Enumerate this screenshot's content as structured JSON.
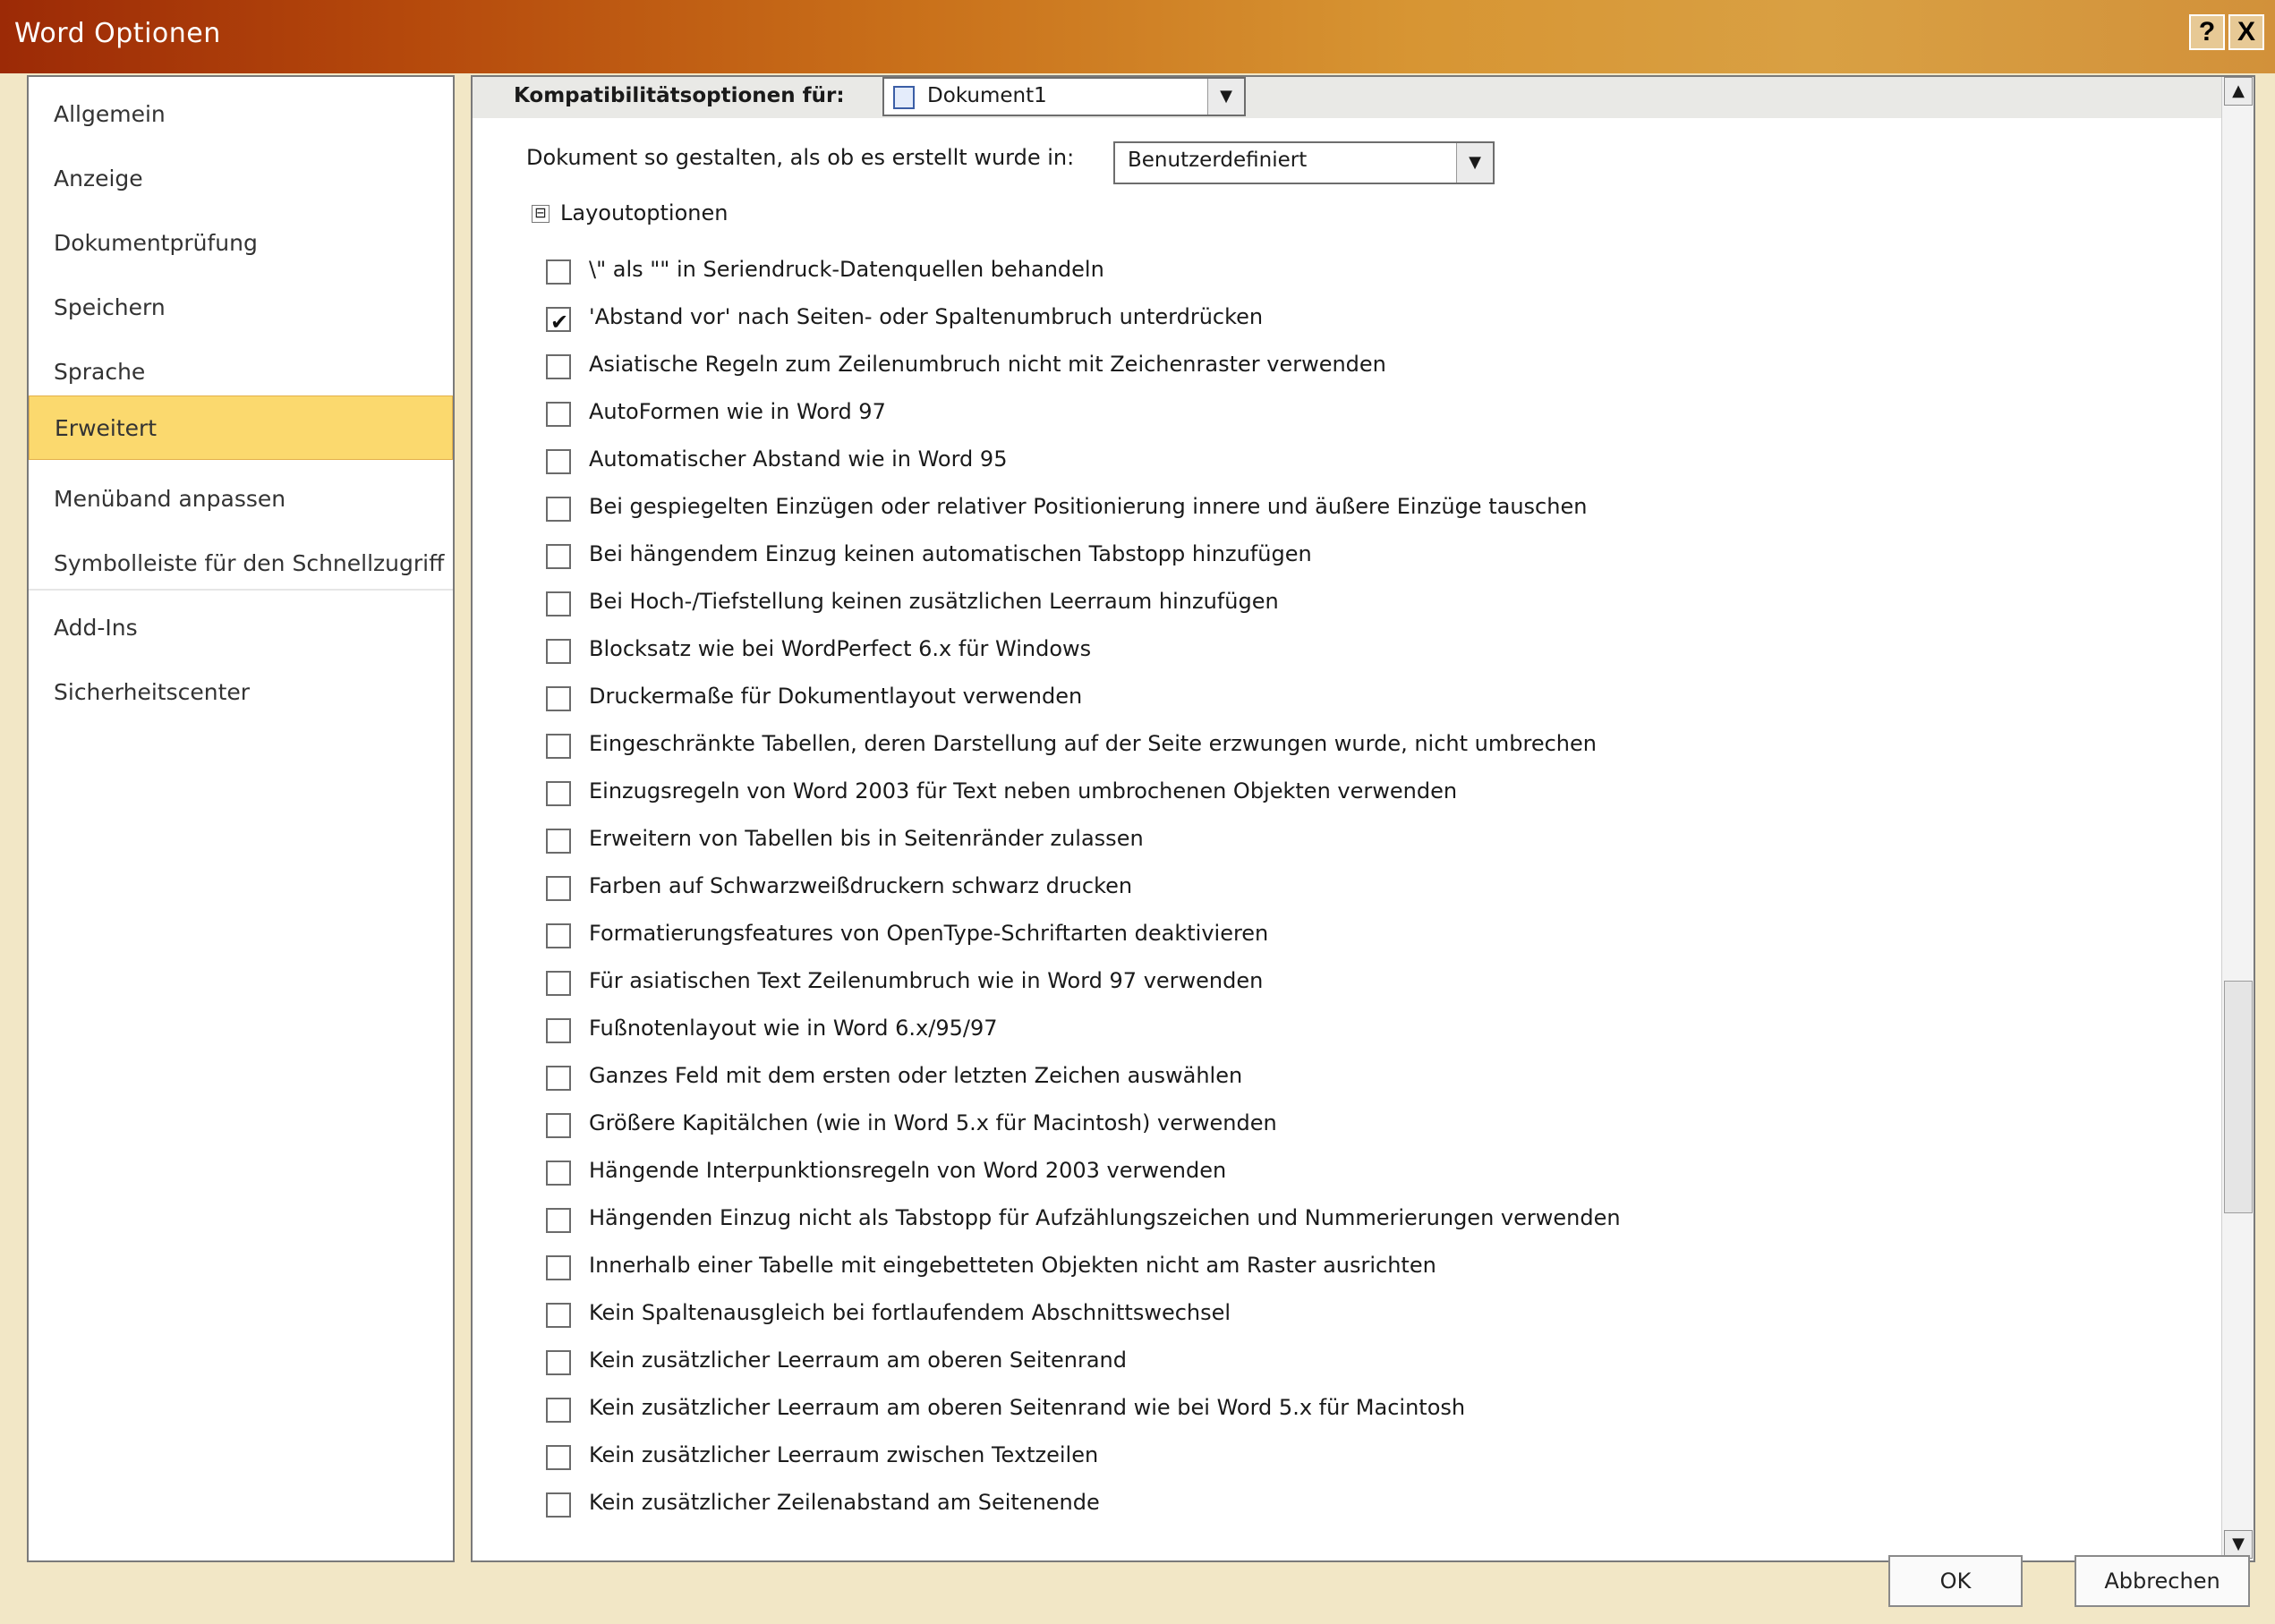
{
  "window": {
    "title": "Word Optionen",
    "help_label": "?",
    "close_label": "X"
  },
  "sidebar": {
    "items": [
      {
        "label": "Allgemein"
      },
      {
        "label": "Anzeige"
      },
      {
        "label": "Dokumentprüfung"
      },
      {
        "label": "Speichern"
      },
      {
        "label": "Sprache"
      },
      {
        "label": "Erweitert",
        "active": true
      },
      {
        "label": "Menüband anpassen"
      },
      {
        "label": "Symbolleiste für den Schnellzugriff"
      },
      {
        "label": "Add-Ins"
      },
      {
        "label": "Sicherheitscenter"
      }
    ]
  },
  "main": {
    "compat_label": "Kompatibilitätsoptionen für:",
    "compat_document": "Dokument1",
    "docgen_label": "Dokument so gestalten, als ob es erstellt wurde in:",
    "docgen_value": "Benutzerdefiniert",
    "layout_heading": "Layoutoptionen",
    "layout_toggle": "⊟",
    "options": [
      {
        "label": "\\\" als \"\" in Seriendruck-Datenquellen behandeln",
        "checked": false
      },
      {
        "label": "'Abstand vor' nach Seiten- oder Spaltenumbruch unterdrücken",
        "checked": true
      },
      {
        "label": "Asiatische Regeln zum Zeilenumbruch nicht mit Zeichenraster verwenden",
        "checked": false
      },
      {
        "label": "AutoFormen wie in Word 97",
        "checked": false
      },
      {
        "label": "Automatischer Abstand wie in Word 95",
        "checked": false
      },
      {
        "label": "Bei gespiegelten Einzügen oder relativer Positionierung innere und äußere Einzüge tauschen",
        "checked": false
      },
      {
        "label": "Bei hängendem Einzug keinen automatischen Tabstopp hinzufügen",
        "checked": false
      },
      {
        "label": "Bei Hoch-/Tiefstellung keinen zusätzlichen Leerraum hinzufügen",
        "checked": false
      },
      {
        "label": "Blocksatz wie bei WordPerfect 6.x für Windows",
        "checked": false
      },
      {
        "label": "Druckermaße für Dokumentlayout verwenden",
        "checked": false
      },
      {
        "label": "Eingeschränkte Tabellen, deren Darstellung auf der Seite erzwungen wurde, nicht umbrechen",
        "checked": false
      },
      {
        "label": "Einzugsregeln von Word 2003 für Text neben umbrochenen Objekten verwenden",
        "checked": false
      },
      {
        "label": "Erweitern von Tabellen bis in Seitenränder zulassen",
        "checked": false
      },
      {
        "label": "Farben auf Schwarzweißdruckern schwarz drucken",
        "checked": false
      },
      {
        "label": "Formatierungsfeatures von OpenType-Schriftarten deaktivieren",
        "checked": false
      },
      {
        "label": "Für asiatischen Text Zeilenumbruch wie in Word 97 verwenden",
        "checked": false
      },
      {
        "label": "Fußnotenlayout wie in Word 6.x/95/97",
        "checked": false
      },
      {
        "label": "Ganzes Feld mit dem ersten oder letzten Zeichen auswählen",
        "checked": false
      },
      {
        "label": "Größere Kapitälchen (wie in Word 5.x für Macintosh) verwenden",
        "checked": false
      },
      {
        "label": "Hängende Interpunktionsregeln von Word 2003 verwenden",
        "checked": false
      },
      {
        "label": "Hängenden Einzug nicht als Tabstopp für Aufzählungszeichen und Nummerierungen verwenden",
        "checked": false
      },
      {
        "label": "Innerhalb einer Tabelle mit eingebetteten Objekten nicht am Raster ausrichten",
        "checked": false
      },
      {
        "label": "Kein Spaltenausgleich bei fortlaufendem Abschnittswechsel",
        "checked": false
      },
      {
        "label": "Kein zusätzlicher Leerraum am oberen Seitenrand",
        "checked": false
      },
      {
        "label": "Kein zusätzlicher Leerraum am oberen Seitenrand wie bei Word 5.x für Macintosh",
        "checked": false
      },
      {
        "label": "Kein zusätzlicher Leerraum zwischen Textzeilen",
        "checked": false
      },
      {
        "label": "Kein zusätzlicher Zeilenabstand am Seitenende",
        "checked": false
      }
    ]
  },
  "footer": {
    "ok_label": "OK",
    "cancel_label": "Abbrechen"
  },
  "colors": {
    "title_bar_start": "#9c2a06",
    "title_bar_end": "#d9a043",
    "active_nav": "#fbd96e",
    "dialog_background": "#f2e7c6"
  }
}
